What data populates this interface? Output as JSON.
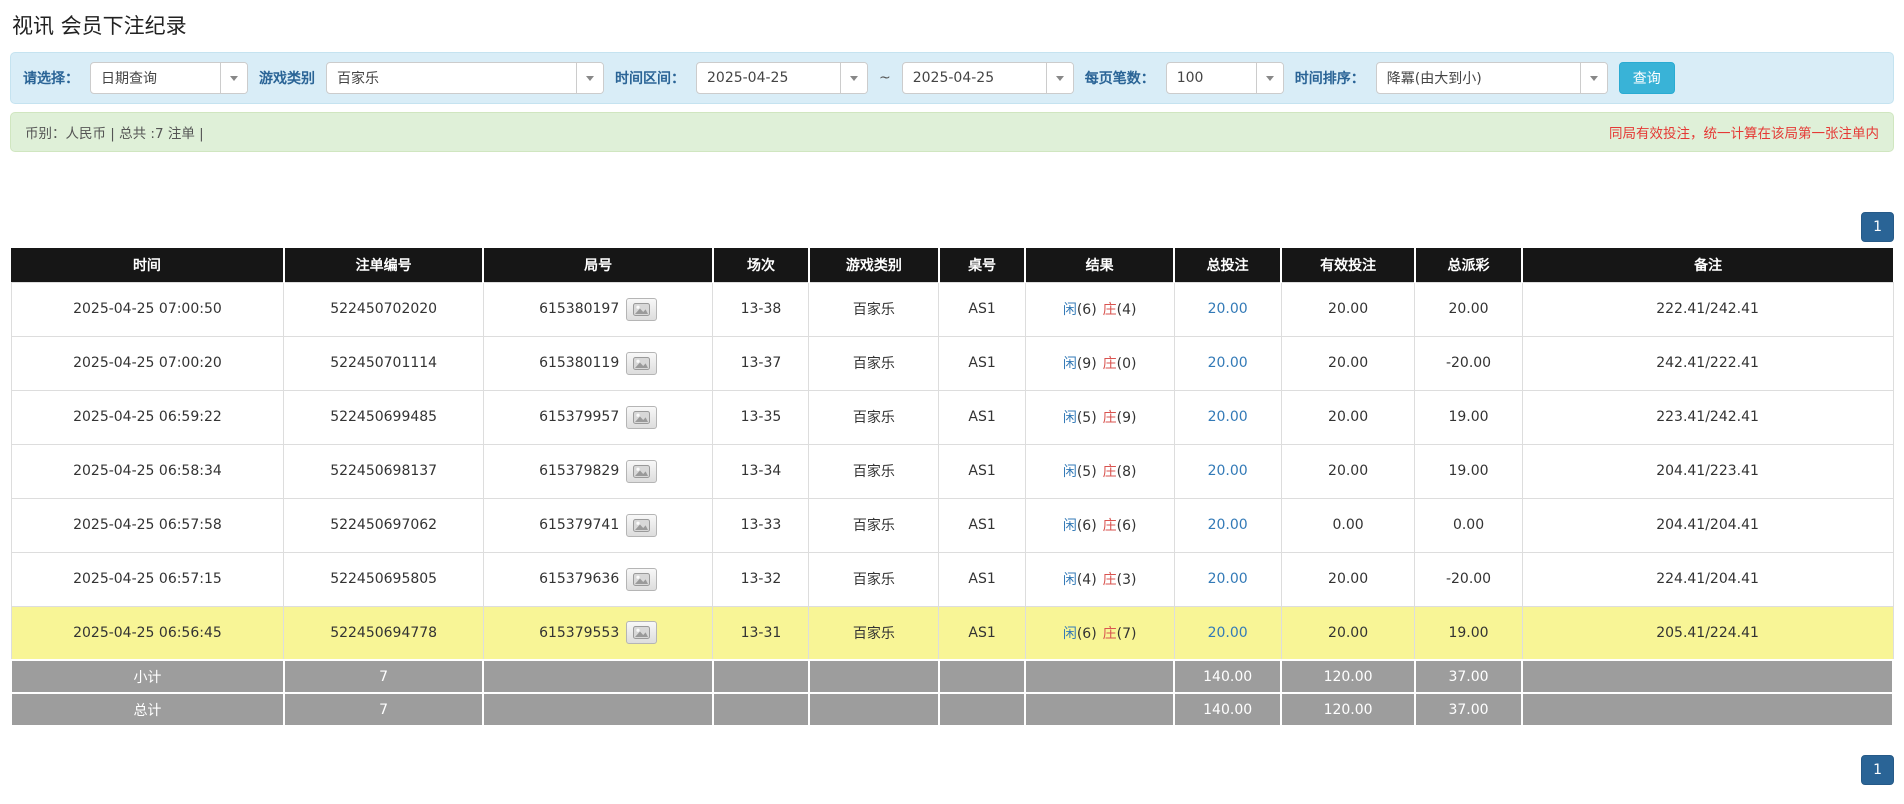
{
  "page": {
    "title": "视讯 会员下注纪录"
  },
  "filters": {
    "select_label": "请选择：",
    "select_value": "日期查询",
    "game_label": "游戏类别",
    "game_value": "百家乐",
    "range_label": "时间区间：",
    "date_from": "2025-04-25",
    "range_sep": "~",
    "date_to": "2025-04-25",
    "page_size_label": "每页笔数：",
    "page_size_value": "100",
    "sort_label": "时间排序：",
    "sort_value": "降冪(由大到小)",
    "search_button": "查询"
  },
  "summary": {
    "currency_info": "币别：人民币 | 总共 :7 注单 |",
    "notice": "同局有效投注，统一计算在该局第一张注单内"
  },
  "pagination": {
    "page": "1"
  },
  "colors": {
    "accent_blue": "#39b3d7",
    "link_blue": "#337ab7",
    "banker_red": "#d9534f",
    "negative_red": "#e53935",
    "highlight_yellow": "#f8f596",
    "header_black": "#161616",
    "footer_gray": "#9d9d9d",
    "filter_bg": "#d9edf7",
    "summary_bg": "#dff0d8"
  },
  "table": {
    "headers": [
      "时间",
      "注单编号",
      "局号",
      "场次",
      "游戏类别",
      "桌号",
      "结果",
      "总投注",
      "有效投注",
      "总派彩",
      "备注"
    ],
    "rows": [
      {
        "time": "2025-04-25 07:00:50",
        "bet_id": "522450702020",
        "round_id": "615380197",
        "session": "13-38",
        "game": "百家乐",
        "table_no": "AS1",
        "result": {
          "player": "闲",
          "player_pts": "(6)",
          "banker": "庄",
          "banker_pts": "(4)"
        },
        "total_bet": "20.00",
        "valid_bet": "20.00",
        "payout": "20.00",
        "remark": "222.41/242.41"
      },
      {
        "time": "2025-04-25 07:00:20",
        "bet_id": "522450701114",
        "round_id": "615380119",
        "session": "13-37",
        "game": "百家乐",
        "table_no": "AS1",
        "result": {
          "player": "闲",
          "player_pts": "(9)",
          "banker": "庄",
          "banker_pts": "(0)"
        },
        "total_bet": "20.00",
        "valid_bet": "20.00",
        "payout": "-20.00",
        "remark": "242.41/222.41"
      },
      {
        "time": "2025-04-25 06:59:22",
        "bet_id": "522450699485",
        "round_id": "615379957",
        "session": "13-35",
        "game": "百家乐",
        "table_no": "AS1",
        "result": {
          "player": "闲",
          "player_pts": "(5)",
          "banker": "庄",
          "banker_pts": "(9)"
        },
        "total_bet": "20.00",
        "valid_bet": "20.00",
        "payout": "19.00",
        "remark": "223.41/242.41"
      },
      {
        "time": "2025-04-25 06:58:34",
        "bet_id": "522450698137",
        "round_id": "615379829",
        "session": "13-34",
        "game": "百家乐",
        "table_no": "AS1",
        "result": {
          "player": "闲",
          "player_pts": "(5)",
          "banker": "庄",
          "banker_pts": "(8)"
        },
        "total_bet": "20.00",
        "valid_bet": "20.00",
        "payout": "19.00",
        "remark": "204.41/223.41"
      },
      {
        "time": "2025-04-25 06:57:58",
        "bet_id": "522450697062",
        "round_id": "615379741",
        "session": "13-33",
        "game": "百家乐",
        "table_no": "AS1",
        "result": {
          "player": "闲",
          "player_pts": "(6)",
          "banker": "庄",
          "banker_pts": "(6)"
        },
        "total_bet": "20.00",
        "valid_bet": "0.00",
        "payout": "0.00",
        "remark": "204.41/204.41"
      },
      {
        "time": "2025-04-25 06:57:15",
        "bet_id": "522450695805",
        "round_id": "615379636",
        "session": "13-32",
        "game": "百家乐",
        "table_no": "AS1",
        "result": {
          "player": "闲",
          "player_pts": "(4)",
          "banker": "庄",
          "banker_pts": "(3)"
        },
        "total_bet": "20.00",
        "valid_bet": "20.00",
        "payout": "-20.00",
        "remark": "224.41/204.41"
      },
      {
        "time": "2025-04-25 06:56:45",
        "bet_id": "522450694778",
        "round_id": "615379553",
        "session": "13-31",
        "game": "百家乐",
        "table_no": "AS1",
        "result": {
          "player": "闲",
          "player_pts": "(6)",
          "banker": "庄",
          "banker_pts": "(7)"
        },
        "total_bet": "20.00",
        "valid_bet": "20.00",
        "payout": "19.00",
        "remark": "205.41/224.41"
      }
    ],
    "subtotal": {
      "label": "小计",
      "count": "7",
      "total_bet": "140.00",
      "valid_bet": "120.00",
      "payout": "37.00"
    },
    "total": {
      "label": "总计",
      "count": "7",
      "total_bet": "140.00",
      "valid_bet": "120.00",
      "payout": "37.00"
    }
  }
}
